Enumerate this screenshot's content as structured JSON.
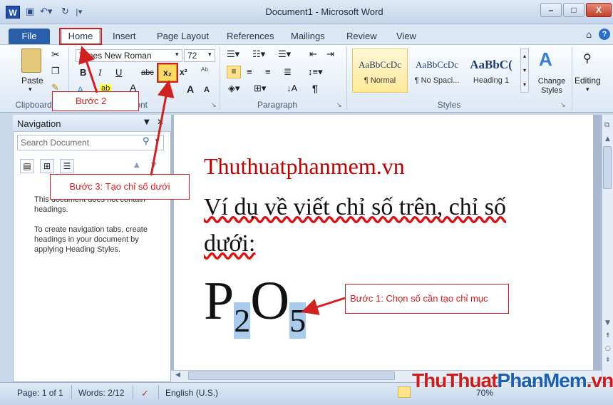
{
  "app": {
    "title": "Document1 - Microsoft Word",
    "icon_letter": "W",
    "window_buttons": {
      "minimize": "–",
      "maximize": "□",
      "close": "X"
    }
  },
  "tabs": [
    {
      "label": "File"
    },
    {
      "label": "Home"
    },
    {
      "label": "Insert"
    },
    {
      "label": "Page Layout"
    },
    {
      "label": "References"
    },
    {
      "label": "Mailings"
    },
    {
      "label": "Review"
    },
    {
      "label": "View"
    }
  ],
  "ribbon": {
    "clipboard": {
      "paste": "Paste",
      "group": "Clipboard"
    },
    "font": {
      "family": "Times New Roman",
      "size": "72",
      "bold": "B",
      "italic": "I",
      "underline": "U",
      "strike": "abc",
      "subscript": "x₂",
      "superscript": "x²",
      "grow": "A",
      "shrink": "A",
      "group": "Font"
    },
    "paragraph": {
      "group": "Paragraph",
      "pilcrow": "¶"
    },
    "styles": {
      "items": [
        {
          "sample": "AaBbCcDc",
          "name": "¶ Normal"
        },
        {
          "sample": "AaBbCcDc",
          "name": "¶ No Spaci..."
        },
        {
          "sample": "AaBbC(",
          "name": "Heading 1"
        }
      ],
      "change_styles": "Change Styles",
      "group": "Styles"
    },
    "editing": {
      "label": "Editing"
    }
  },
  "navigation": {
    "title": "Navigation",
    "search_placeholder": "Search Document",
    "message1": "This document does not contain headings.",
    "message2": "To create navigation tabs, create headings in your document by applying Heading Styles."
  },
  "document": {
    "site": "Thuthuatphanmem.vn",
    "line1": "Ví dụ về viết chỉ số trên, chỉ số",
    "line2": "dưới:",
    "formula": {
      "p": "P",
      "sub1": "2",
      "o": "O",
      "sub2": "5"
    }
  },
  "status": {
    "page": "Page: 1 of 1",
    "words": "Words: 2/12",
    "language": "English (U.S.)",
    "zoom": "70%"
  },
  "annotations": {
    "step1": "Bước 1: Chọn số cần tạo chỉ mục",
    "step2": "Bước 2",
    "step3": "Bước 3: Tạo chỉ số dưới"
  },
  "watermark": {
    "part1": "ThuThuat",
    "part2": "PhanMem",
    "part3": ".vn"
  },
  "colors": {
    "accent": "#2a5ea8",
    "annotation": "#d02020",
    "selection": "#a8cbee"
  }
}
